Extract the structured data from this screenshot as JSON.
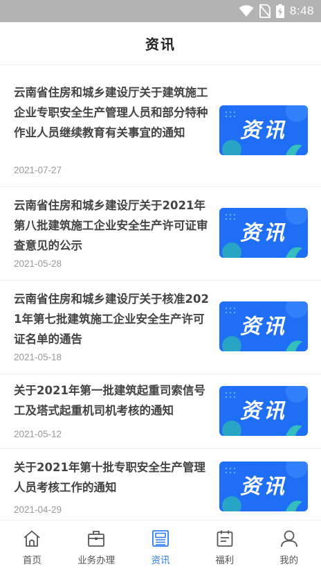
{
  "status_bar": {
    "time": "8:48"
  },
  "header": {
    "title": "资讯"
  },
  "thumbnail": {
    "label": "资讯"
  },
  "news": [
    {
      "title": "云南省住房和城乡建设厅关于建筑施工企业专职安全生产管理人员和部分特种作业人员继续教育有关事宜的通知",
      "date": "2021-07-27"
    },
    {
      "title": "云南省住房和城乡建设厅关于2021年第八批建筑施工企业安全生产许可证审查意见的公示",
      "date": "2021-05-28"
    },
    {
      "title": "云南省住房和城乡建设厅关于核准2021年第七批建筑施工企业安全生产许可证名单的通告",
      "date": "2021-05-18"
    },
    {
      "title": "关于2021年第一批建筑起重司索信号工及塔式起重机司机考核的通知",
      "date": "2021-05-12"
    },
    {
      "title": "关于2021年第十批专职安全生产管理人员考核工作的通知",
      "date": "2021-04-29"
    }
  ],
  "tabs": [
    {
      "label": "首页",
      "icon": "home-icon"
    },
    {
      "label": "业务办理",
      "icon": "briefcase-icon"
    },
    {
      "label": "资讯",
      "icon": "news-icon",
      "active": true
    },
    {
      "label": "福利",
      "icon": "calendar-icon"
    },
    {
      "label": "我的",
      "icon": "user-icon"
    }
  ],
  "colors": {
    "accent": "#2b7cf2",
    "status_bar": "#b3b3b3",
    "thumb_blue": "#1e6ff5"
  }
}
